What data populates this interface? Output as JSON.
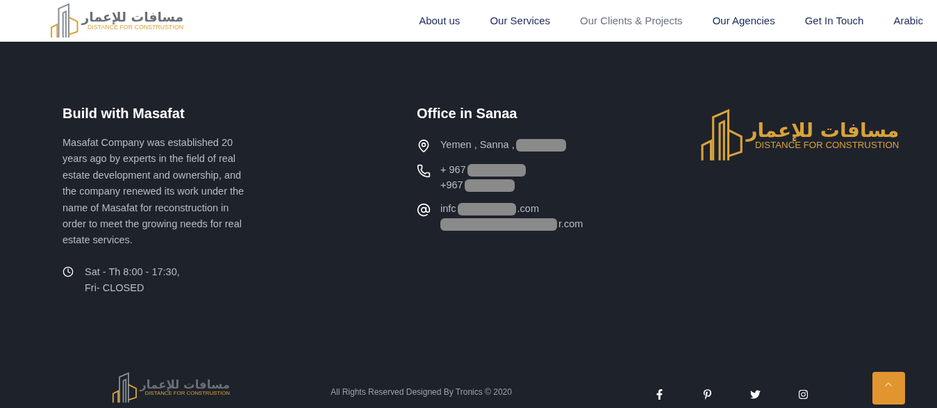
{
  "header": {
    "logo": {
      "arabic": "مسافات للإعمار",
      "english": "DISTANCE FOR CONSTRUSTION"
    },
    "nav": [
      {
        "label": "About us",
        "selected": false
      },
      {
        "label": "Our Services",
        "selected": false
      },
      {
        "label": "Our Clients & Projects",
        "selected": true
      },
      {
        "label": "Our Agencies",
        "selected": false
      },
      {
        "label": "Get In Touch",
        "selected": false
      },
      {
        "label": "Arabic",
        "selected": false
      }
    ]
  },
  "about": {
    "title": "Build with Masafat",
    "text": "Masafat Company was established 20 years ago by experts in the field of real estate development and ownership, and the company renewed its work under the name of Masafat for reconstruction in order to meet the growing needs for real estate services.",
    "hours": [
      "Sat - Th 8:00 - 17:30,",
      "Fri- CLOSED"
    ]
  },
  "office": {
    "title": "Office in Sanaa",
    "contacts": [
      {
        "kind": "location",
        "lines": [
          {
            "text": "Yemen , Sanna ,",
            "redacted_after": true
          }
        ]
      },
      {
        "kind": "phone",
        "lines": [
          {
            "text": "+ 967",
            "redacted_after": true
          },
          {
            "text": "+967",
            "redacted_after": true
          }
        ]
      },
      {
        "kind": "email",
        "lines": [
          {
            "text": "infc",
            "redacted_after": true,
            "tail": ".com"
          },
          {
            "redacted_before": true,
            "tail": "r.com"
          }
        ]
      }
    ]
  },
  "side_logo": {
    "arabic": "مسافات للإعمار",
    "english": "DISTANCE FOR CONSTRUSTION"
  },
  "footer": {
    "logo": {
      "arabic": "مسافات للإعمار",
      "english": "DISTANCE FOR CONSTRUSTION"
    },
    "copyright": "All Rights Reserved Designed By Tronics © 2020",
    "social": [
      {
        "kind": "facebook"
      },
      {
        "kind": "pinterest"
      },
      {
        "kind": "twitter"
      },
      {
        "kind": "instagram"
      }
    ]
  }
}
